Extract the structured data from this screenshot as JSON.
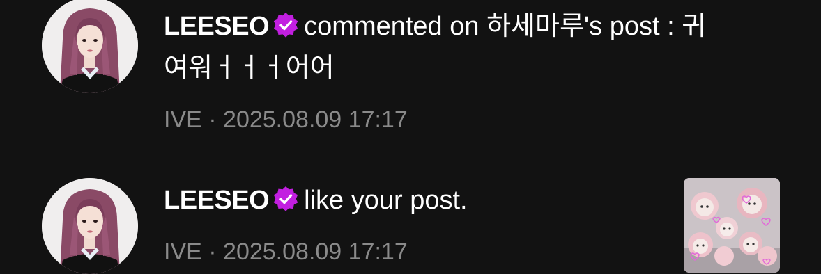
{
  "notifications": [
    {
      "avatar_icon": "profile-photo",
      "username": "LEESEO",
      "verified_icon": "verified-badge-icon",
      "action_text": "commented on 하세마루's post : 귀",
      "action_text_cont": "여워ㅓㅓㅓ어어",
      "group": "IVE",
      "separator": "·",
      "timestamp": "2025.08.09 17:17"
    },
    {
      "avatar_icon": "profile-photo",
      "username": "LEESEO",
      "verified_icon": "verified-badge-icon",
      "action_text": "like your post.",
      "group": "IVE",
      "separator": "·",
      "timestamp": "2025.08.09 17:17",
      "post_thumbnail_icon": "post-thumbnail-image"
    }
  ],
  "colors": {
    "background": "#121212",
    "text": "#ffffff",
    "meta_text": "#8a8a8a",
    "verified_badge": "#c21fe0"
  }
}
